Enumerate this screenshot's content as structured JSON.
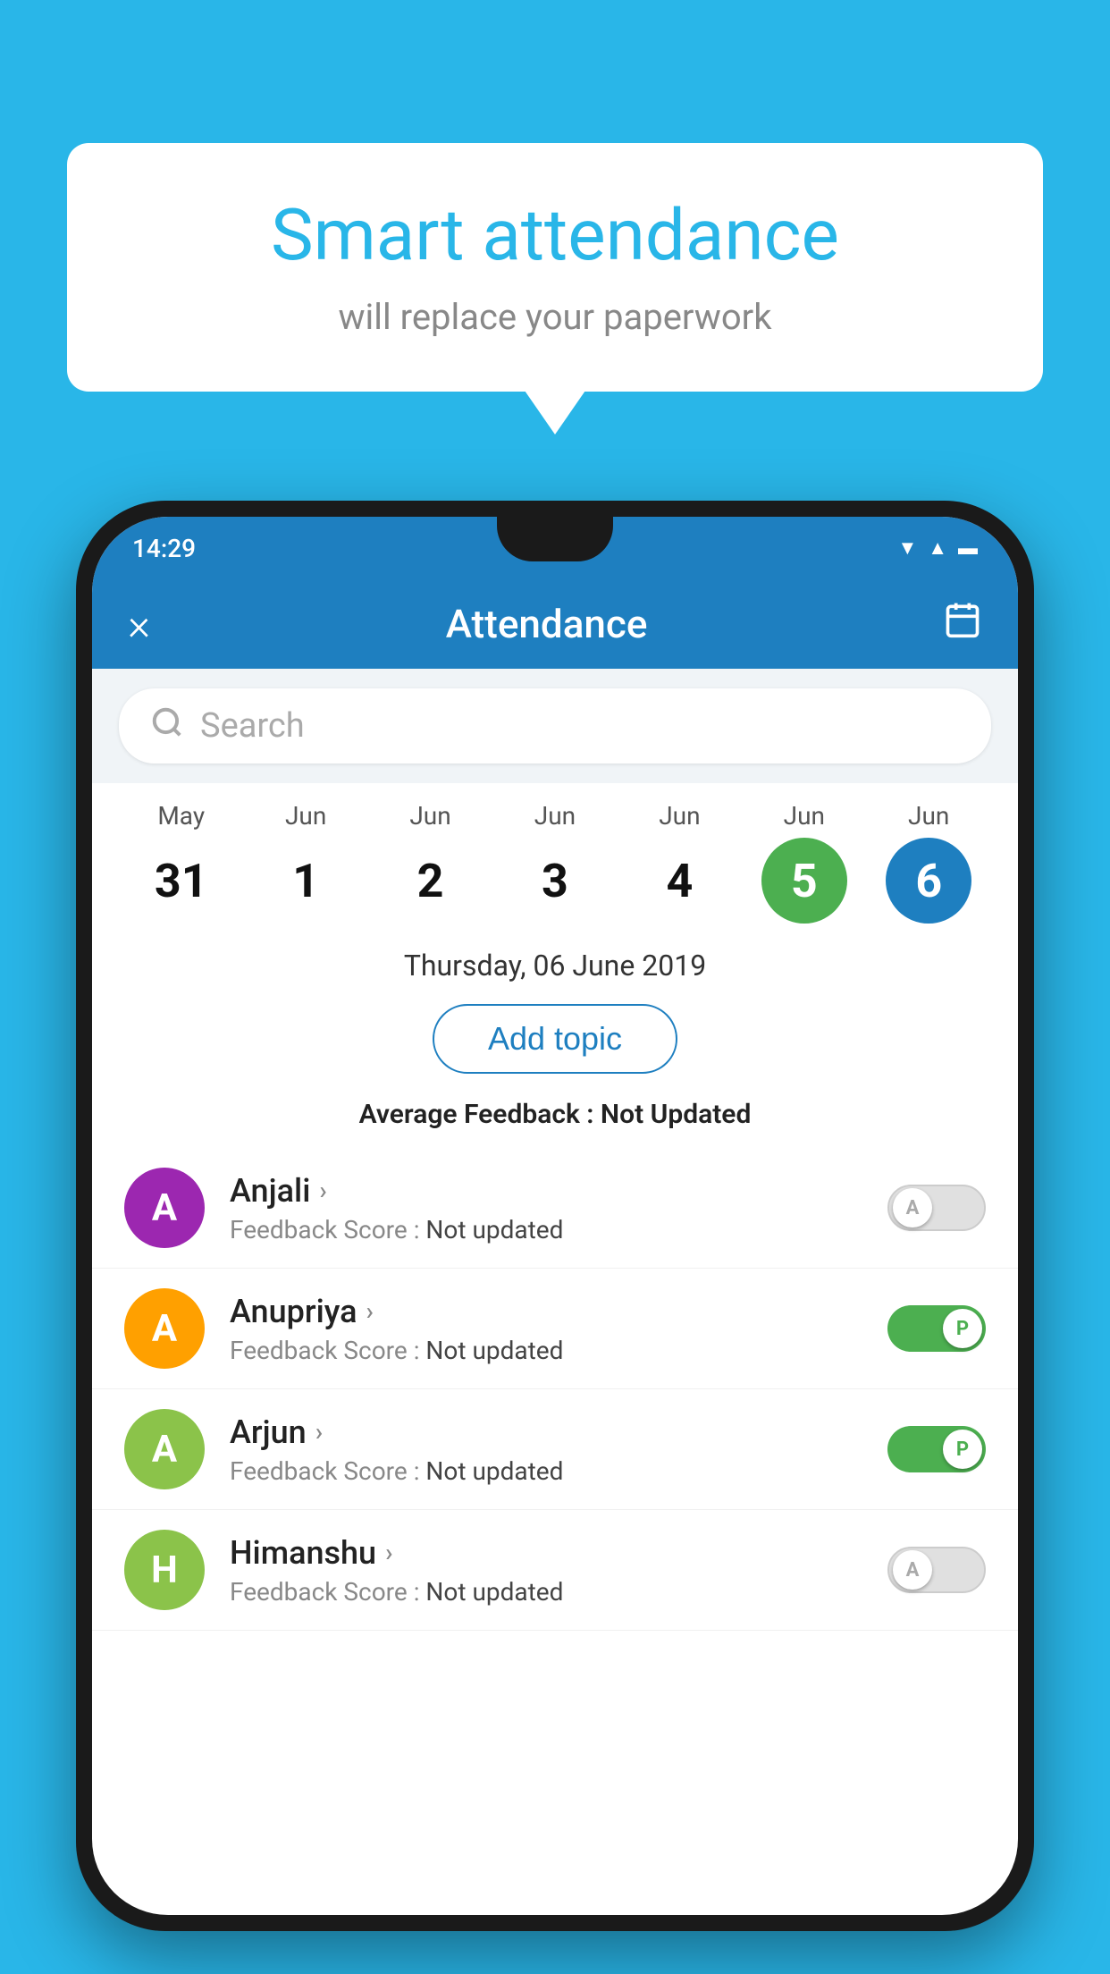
{
  "background": {
    "color": "#29b6e8"
  },
  "bubble": {
    "title": "Smart attendance",
    "subtitle": "will replace your paperwork"
  },
  "statusBar": {
    "time": "14:29",
    "icons": [
      "wifi",
      "signal",
      "battery"
    ]
  },
  "header": {
    "title": "Attendance",
    "close_label": "×",
    "calendar_icon": "📅"
  },
  "search": {
    "placeholder": "Search"
  },
  "calendar": {
    "days": [
      {
        "month": "May",
        "day": "31",
        "state": "normal"
      },
      {
        "month": "Jun",
        "day": "1",
        "state": "normal"
      },
      {
        "month": "Jun",
        "day": "2",
        "state": "normal"
      },
      {
        "month": "Jun",
        "day": "3",
        "state": "normal"
      },
      {
        "month": "Jun",
        "day": "4",
        "state": "normal"
      },
      {
        "month": "Jun",
        "day": "5",
        "state": "today"
      },
      {
        "month": "Jun",
        "day": "6",
        "state": "selected"
      }
    ]
  },
  "selectedDate": "Thursday, 06 June 2019",
  "addTopic": "Add topic",
  "averageFeedback": {
    "label": "Average Feedback : ",
    "value": "Not Updated"
  },
  "students": [
    {
      "name": "Anjali",
      "avatar_letter": "A",
      "avatar_color": "#9c27b0",
      "feedback": "Not updated",
      "toggle_state": "off",
      "toggle_label": "A"
    },
    {
      "name": "Anupriya",
      "avatar_letter": "A",
      "avatar_color": "#ffa000",
      "feedback": "Not updated",
      "toggle_state": "on",
      "toggle_label": "P"
    },
    {
      "name": "Arjun",
      "avatar_letter": "A",
      "avatar_color": "#8bc34a",
      "feedback": "Not updated",
      "toggle_state": "on",
      "toggle_label": "P"
    },
    {
      "name": "Himanshu",
      "avatar_letter": "H",
      "avatar_color": "#8bc34a",
      "feedback": "Not updated",
      "toggle_state": "off",
      "toggle_label": "A"
    }
  ]
}
